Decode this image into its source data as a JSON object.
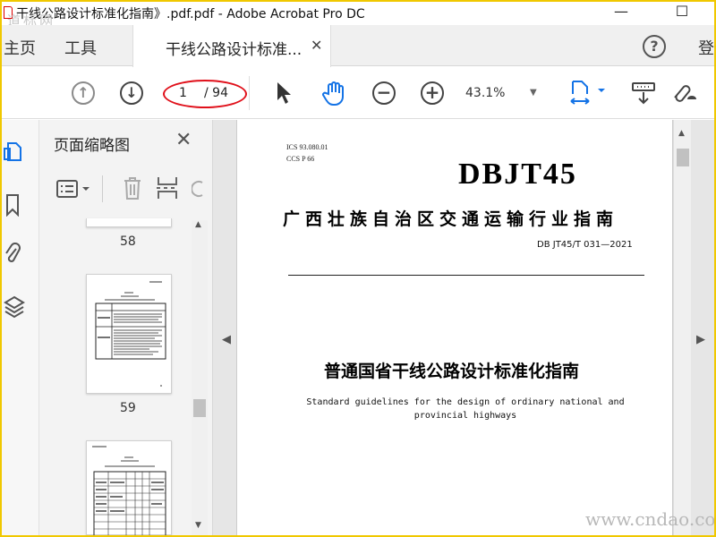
{
  "window": {
    "title": "干线公路设计标准化指南》.pdf.pdf - Adobe Acrobat Pro DC",
    "minimize": "—",
    "maximize": "☐",
    "watermark_top_left": "道标网"
  },
  "tabs": {
    "home": "主页",
    "tools": "工具",
    "document": "干线公路设计标准...",
    "close": "✕",
    "help": "?",
    "login": "登"
  },
  "toolbar": {
    "page_current": "1",
    "page_total": "/ 94",
    "zoom": "43.1%",
    "zoom_caret": "▼"
  },
  "thumbnails_panel": {
    "title": "页面缩略图",
    "close": "✕",
    "pages": [
      {
        "number": "58"
      },
      {
        "number": "59"
      }
    ]
  },
  "document": {
    "ics": "ICS  93.080.01",
    "ccs": "CCS  P 66",
    "logo": "DBJT45",
    "guide_title": "广西壮族自治区交通运输行业指南",
    "code": "DB JT45/T 031—2021",
    "chinese_title": "普通国省干线公路设计标准化指南",
    "english_title": "Standard guidelines for the design of ordinary national and provincial highways"
  },
  "watermark_bottom_right": "www.cndao.com",
  "colors": {
    "frame": "#f0c800",
    "accent": "#1473e6",
    "highlight_oval": "#e0101a"
  }
}
